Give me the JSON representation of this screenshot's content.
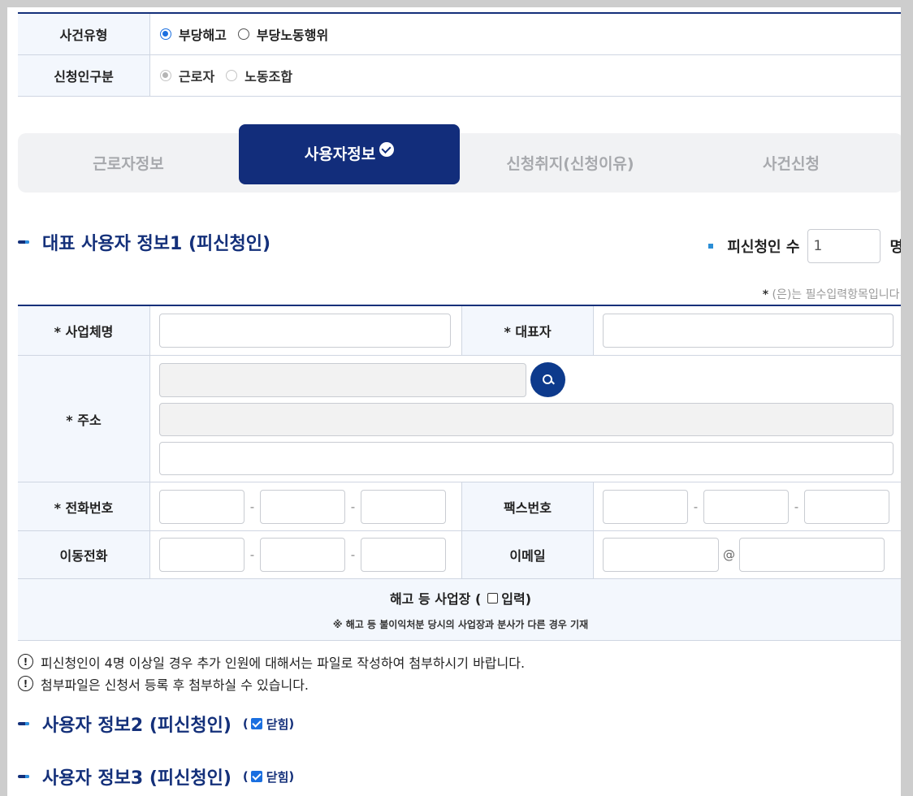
{
  "case_info": {
    "case_type_label": "사건유형",
    "case_type_options": [
      {
        "label": "부당해고",
        "checked": true
      },
      {
        "label": "부당노동행위",
        "checked": false
      }
    ],
    "applicant_type_label": "신청인구분",
    "applicant_type_options": [
      {
        "label": "근로자",
        "checked": true,
        "disabled": true
      },
      {
        "label": "노동조합",
        "checked": false,
        "disabled": true
      }
    ]
  },
  "tabs": [
    {
      "label": "근로자정보",
      "active": false
    },
    {
      "label": "사용자정보",
      "active": true
    },
    {
      "label": "신청취지(신청이유)",
      "active": false
    },
    {
      "label": "사건신청",
      "active": false
    }
  ],
  "section1": {
    "title": "대표 사용자 정보1 (피신청인)",
    "respondent_count_label": "피신청인 수",
    "respondent_count_value": "1",
    "respondent_count_unit": "명",
    "required_note_star": "*",
    "required_note": "(은)는 필수입력항목입니다."
  },
  "form": {
    "business_name_label": "*  사업체명",
    "representative_label": "*  대표자",
    "address_label": "*  주소",
    "phone_label": "*  전화번호",
    "fax_label": "팩스번호",
    "mobile_label": "이동전화",
    "email_label": "이메일",
    "hyphen": "-",
    "at_sign": "@",
    "workplace_title": "해고 등 사업장 (",
    "workplace_input_label": "입력)",
    "workplace_note": "※  해고 등 불이익처분 당시의 사업장과 분사가 다른 경우 기재"
  },
  "notices": [
    "피신청인이 4명 이상일 경우 추가 인원에 대해서는 파일로 작성하여 첨부하시기 바랍니다.",
    "첨부파일은 신청서 등록 후 첨부하실 수 있습니다."
  ],
  "notice_icon": "!",
  "section2": {
    "title": "사용자 정보2 (피신청인)",
    "toggle_label": "닫힘"
  },
  "section3": {
    "title": "사용자 정보3 (피신청인)",
    "toggle_label": "닫힘"
  }
}
